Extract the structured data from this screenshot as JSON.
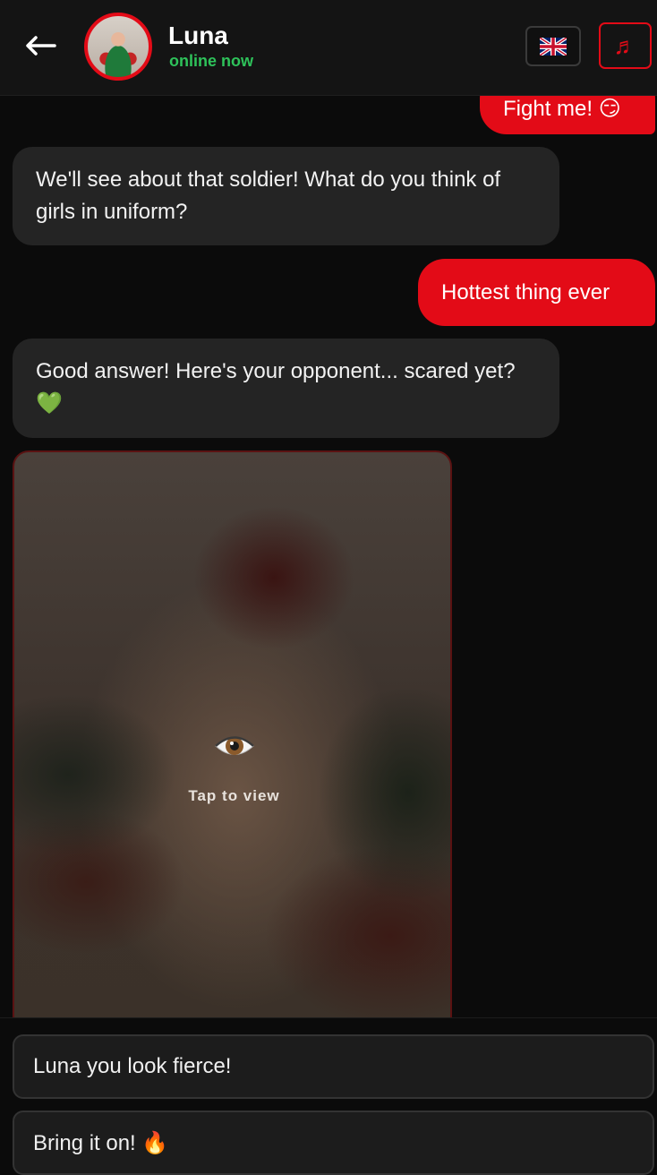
{
  "header": {
    "back_icon": "arrow-left-icon",
    "contact_name": "Luna",
    "status": "online now",
    "language_icon": "uk-flag-icon",
    "music_icon": "music-note-icon",
    "music_glyph": "♬"
  },
  "messages": [
    {
      "sender": "user",
      "text": "Fight me! 😏"
    },
    {
      "sender": "bot",
      "text": "We'll see about that soldier! What do you think of girls in uniform?"
    },
    {
      "sender": "user",
      "text": "Hottest thing ever"
    },
    {
      "sender": "bot",
      "text": "Good answer! Here's your opponent... scared yet? 💚"
    }
  ],
  "photo": {
    "icon": "eye-icon",
    "label": "Tap to view"
  },
  "suggestions": [
    {
      "text": "Luna you look fierce!"
    },
    {
      "text": "Bring it on! 🔥"
    }
  ],
  "colors": {
    "accent": "#e30b17",
    "online": "#2ec25a",
    "bot_bubble": "#242424",
    "background": "#0b0b0b"
  }
}
